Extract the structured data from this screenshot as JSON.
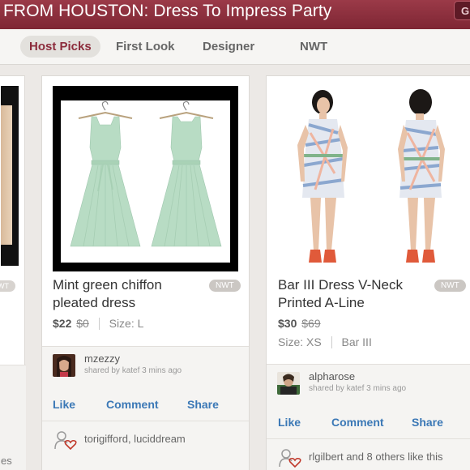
{
  "header": {
    "title": "FROM HOUSTON: Dress To Impress Party",
    "button_label": "G"
  },
  "tabs": [
    {
      "label": "Host Picks",
      "active": true
    },
    {
      "label": "First Look"
    },
    {
      "label": "Designer"
    },
    {
      "label": "NWT"
    }
  ],
  "cards": {
    "left": {
      "badge": "NWT",
      "footer_text": "es"
    },
    "a": {
      "title": "Mint green chiffon pleated dress",
      "badge": "NWT",
      "price": "$22",
      "original_price": "$0",
      "size": "Size: L",
      "username": "mzezzy",
      "shared": "shared by katef 3 mins ago",
      "actions": {
        "like": "Like",
        "comment": "Comment",
        "share": "Share"
      },
      "likers": "torigifford, luciddream"
    },
    "b": {
      "title": "Bar III Dress V-Neck Printed A-Line",
      "badge": "NWT",
      "price": "$30",
      "original_price": "$69",
      "size": "Size: XS",
      "brand": "Bar III",
      "username": "alpharose",
      "shared": "shared by katef 3 mins ago",
      "actions": {
        "like": "Like",
        "comment": "Comment",
        "share": "Share"
      },
      "likers": "rlgilbert and 8 others like this"
    }
  },
  "colors": {
    "header": "#8a2f3d",
    "accent": "#8c2c3c",
    "link": "#3b78b6",
    "dress": "#b8dcc4"
  }
}
